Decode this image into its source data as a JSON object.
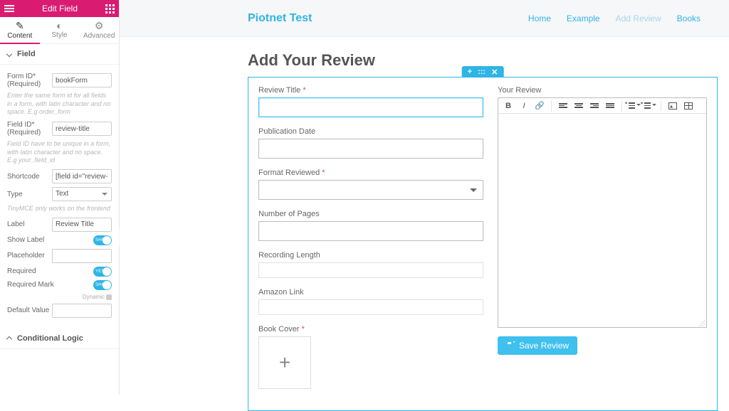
{
  "sidebar": {
    "title": "Edit Field",
    "tabs": {
      "content": "Content",
      "style": "Style",
      "advanced": "Advanced"
    },
    "sections": {
      "field": "Field",
      "conditional": "Conditional Logic"
    },
    "fields": {
      "formid_label": "Form ID* (Required)",
      "formid_value": "bookForm",
      "formid_help": "Enter the same form id for all fields in a form, with latin character and no space. E.g order_form",
      "fieldid_label": "Field ID* (Required)",
      "fieldid_value": "review-title",
      "fieldid_help": "Field ID have to be unique in a form, with latin character and no space. E.g your_field_id",
      "shortcode_label": "Shortcode",
      "shortcode_value": "[field id=\"review-title\"]",
      "type_label": "Type",
      "type_value": "Text",
      "type_help": "TinyMCE only works on the frontend",
      "label_label": "Label",
      "label_value": "Review Title",
      "showlabel_label": "Show Label",
      "showlabel_text": "SHOW",
      "placeholder_label": "Placeholder",
      "placeholder_value": "",
      "required_label": "Required",
      "required_text": "YES",
      "requiredmark_label": "Required Mark",
      "requiredmark_text": "SHOW",
      "dynamic": "Dynamic",
      "default_label": "Default Value",
      "default_value": ""
    }
  },
  "preview": {
    "brand": "Piotnet Test",
    "nav": {
      "home": "Home",
      "example": "Example",
      "add": "Add Review",
      "books": "Books"
    },
    "title": "Add Your Review",
    "handle": {
      "add": "+",
      "move": ":::",
      "close": "✕"
    },
    "left": {
      "reviewtitle": "Review Title",
      "pubdate": "Publication Date",
      "format": "Format Reviewed",
      "pages": "Number of Pages",
      "reclen": "Recording Length",
      "amazon": "Amazon Link",
      "cover": "Book Cover"
    },
    "right": {
      "yourreview": "Your Review",
      "save": "Save Review"
    }
  }
}
